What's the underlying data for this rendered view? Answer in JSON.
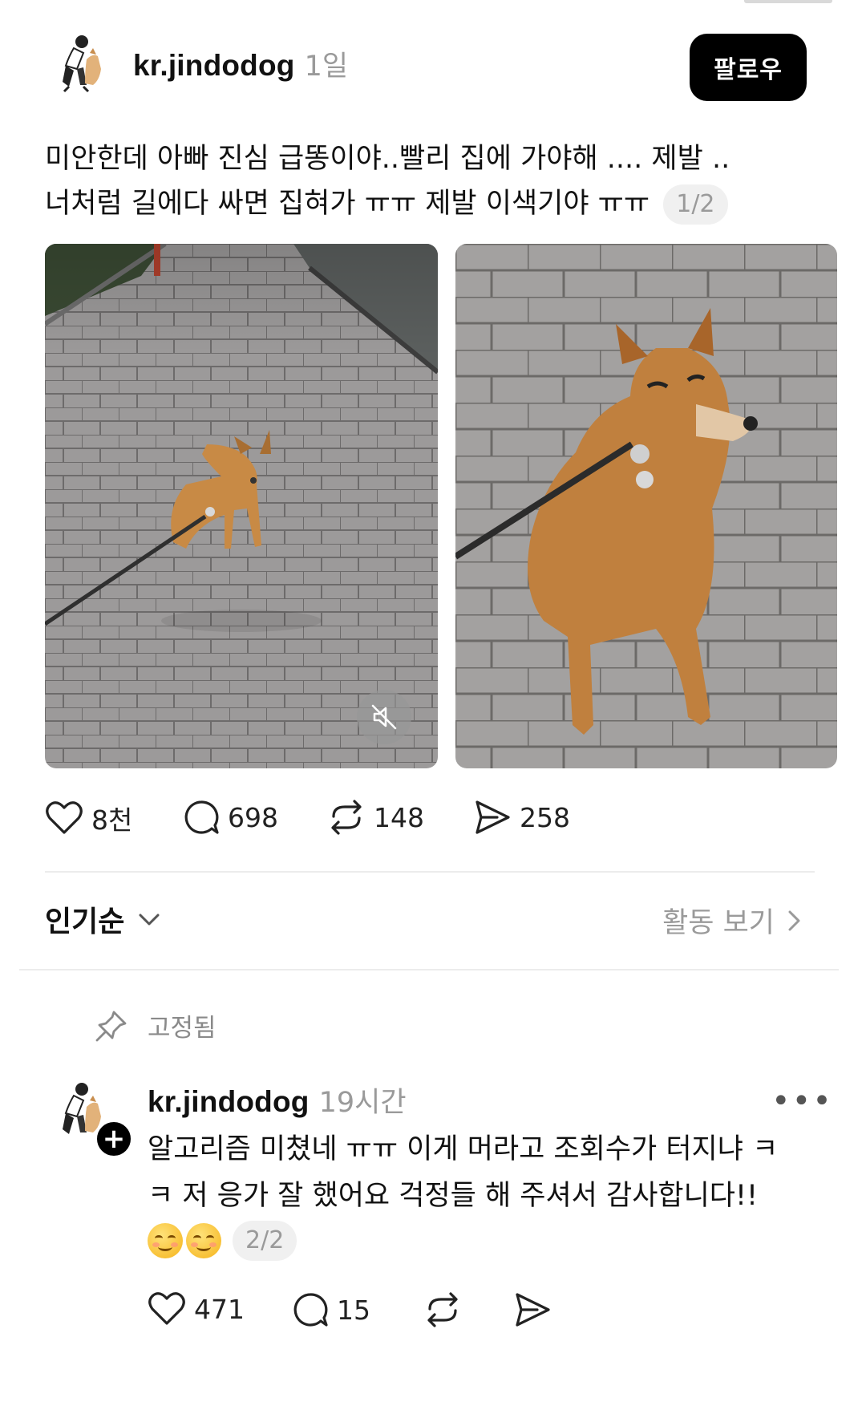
{
  "post": {
    "username": "kr.jindodog",
    "time": "1일",
    "follow_label": "팔로우",
    "text_line1": "미안한데 아빠 진심 급똥이야..빨리 집에 가야해 .... 제발 ..",
    "text_line2": "너처럼 길에다 싸면 집혀가 ㅠㅠ 제발 이색기야 ㅠㅠ",
    "page_indicator": "1/2",
    "media": [
      {
        "kind": "video",
        "subject": "dog-on-leash-far",
        "muted": true
      },
      {
        "kind": "photo",
        "subject": "dog-on-leash-close"
      }
    ],
    "actions": {
      "likes": "8천",
      "comments": "698",
      "reposts": "148",
      "shares": "258"
    }
  },
  "sort": {
    "label": "인기순",
    "activity_label": "활동 보기"
  },
  "comment": {
    "pinned_label": "고정됨",
    "username": "kr.jindodog",
    "time": "19시간",
    "more_label": "•••",
    "add_badge": "+",
    "text_line1": "알고리즘 미쳤네 ㅠㅠ 이게 머라고 조회수가 터지냐 ㅋ",
    "text_line2": "ㅋ 저 응가 잘 했어요 걱정들 해 주셔서 감사합니다!!",
    "emojis": [
      "smiling-face-icon",
      "smiling-face-icon"
    ],
    "page_indicator": "2/2",
    "actions": {
      "likes": "471",
      "comments": "15"
    }
  },
  "icons": {
    "like": "heart-icon",
    "comment": "speech-bubble-icon",
    "repost": "repost-icon",
    "share": "send-icon",
    "mute": "speaker-muted-icon",
    "pin": "pin-icon",
    "chevron_down": "chevron-down-icon",
    "chevron_right": "chevron-right-icon"
  },
  "colors": {
    "follow_bg": "#000000",
    "secondary_text": "#9a9a9a",
    "pill_bg": "#f0f0f0",
    "divider": "#ececec"
  }
}
